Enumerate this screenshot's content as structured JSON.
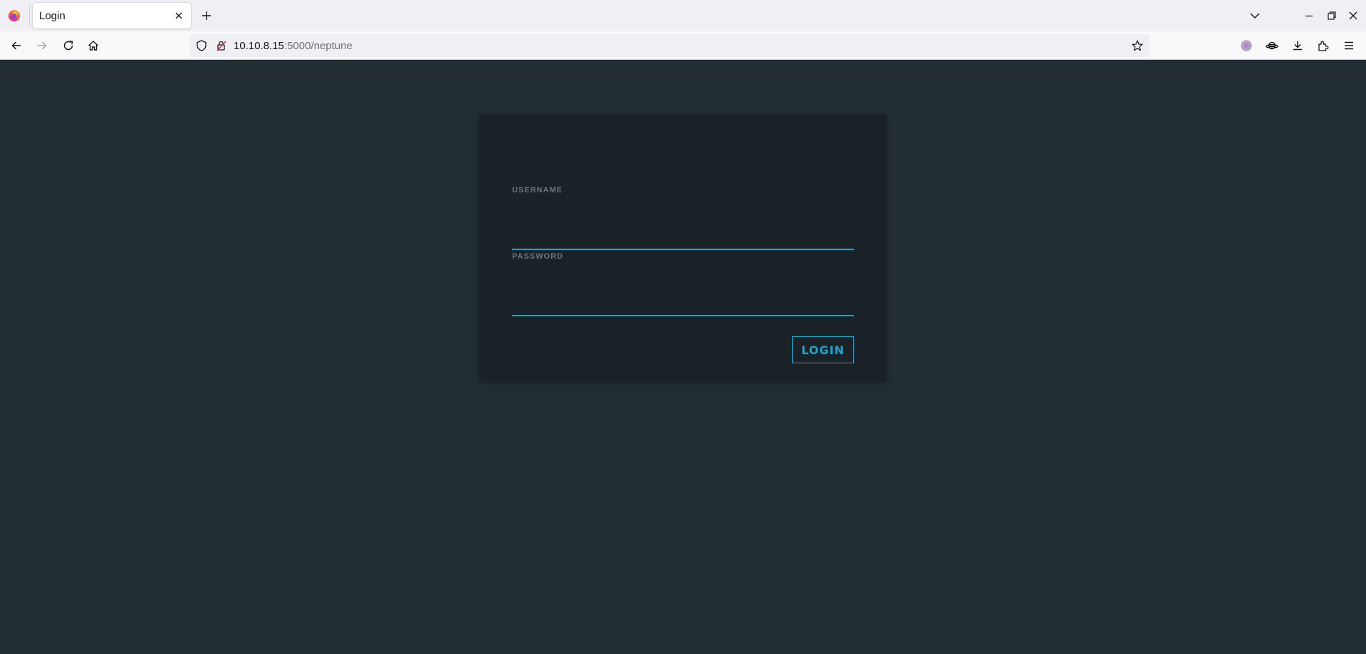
{
  "browser": {
    "tab": {
      "title": "Login"
    },
    "url": {
      "host": "10.10.8.15",
      "rest": ":5000/neptune"
    },
    "colors": {
      "accent": "#1aa6cf",
      "page_background": "#222c33",
      "card_background": "#1b2227"
    },
    "icons": [
      "firefox-logo-icon",
      "close-icon",
      "plus-icon",
      "chevron-down-icon",
      "minimize-icon",
      "restore-icon",
      "window-close-icon",
      "back-arrow-icon",
      "forward-arrow-icon",
      "reload-icon",
      "home-icon",
      "shield-icon",
      "lock-icon",
      "star-icon",
      "profile-icon",
      "saturn-icon",
      "download-icon",
      "extensions-icon",
      "menu-icon"
    ]
  },
  "login_form": {
    "username_label": "USERNAME",
    "username_value": "",
    "password_label": "PASSWORD",
    "password_value": "",
    "submit_label": "LOGIN"
  }
}
